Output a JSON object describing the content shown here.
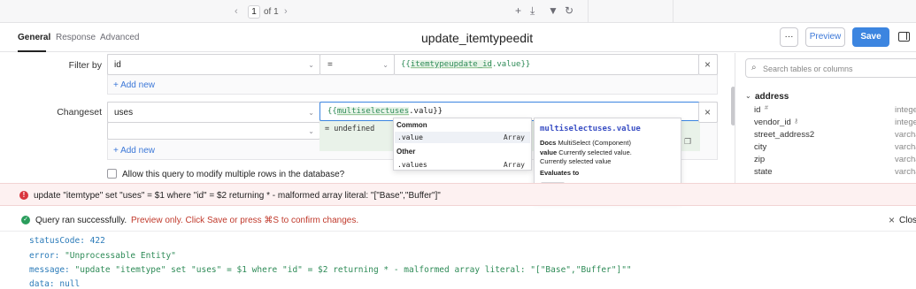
{
  "toolbar": {
    "page_current": "1",
    "page_of": "of 1",
    "prev_icon": "chevron-left-icon",
    "next_icon": "chevron-right-icon",
    "icons": [
      "plus-icon",
      "download-icon",
      "filter-icon",
      "refresh-icon"
    ]
  },
  "header": {
    "tabs": [
      "General",
      "Response",
      "Advanced"
    ],
    "active_tab": "General",
    "title": "update_itemtypeedit",
    "more_label": "···",
    "preview_label": "Preview",
    "save_label": "Save"
  },
  "filter_by": {
    "label": "Filter by",
    "column": "id",
    "operator": "=",
    "value_open": "{{",
    "value_var": "itemtypeupdate_id",
    "value_rest": ".value}}",
    "add_new": "+ Add new"
  },
  "changeset": {
    "label": "Changeset",
    "column": "uses",
    "value_open": "{{",
    "value_var": "multiselectuses",
    "value_rest": ".valu}}",
    "preview_value": "= undefined",
    "add_new": "+ Add new"
  },
  "checkbox": {
    "label": "Allow this query to modify multiple rows in the database?",
    "checked": false
  },
  "autocomplete": {
    "groups": [
      {
        "name": "Common",
        "items": [
          {
            "label": ".value",
            "type": "Array"
          }
        ]
      },
      {
        "name": "Other",
        "items": [
          {
            "label": ".values",
            "type": "Array"
          }
        ]
      }
    ]
  },
  "doc_popup": {
    "title": "multiselectuses.value",
    "docs_label": "Docs",
    "docs_text": "MultiSelect (Component)",
    "value_key": "value",
    "value_desc": "Currently selected value.",
    "value_desc2": "Currently selected value",
    "evaluates_label": "Evaluates to",
    "evaluates_value": "[ ··· ]"
  },
  "sidebar": {
    "search_placeholder": "Search tables or columns",
    "table_name": "address",
    "columns": [
      {
        "name": "id",
        "marker": "#",
        "type": "intege"
      },
      {
        "name": "vendor_id",
        "marker": "⚷",
        "type": "intege"
      },
      {
        "name": "street_address2",
        "marker": "",
        "type": "varcha"
      },
      {
        "name": "city",
        "marker": "",
        "type": "varcha"
      },
      {
        "name": "zip",
        "marker": "",
        "type": "varcha"
      },
      {
        "name": "state",
        "marker": "",
        "type": "varcha"
      }
    ]
  },
  "error": {
    "message": "update \"itemtype\" set \"uses\" = $1 where \"id\" = $2 returning * - malformed array literal: \"[\"Base\",\"Buffer\"]\""
  },
  "status": {
    "success_text": "Query ran successfully.",
    "preview_bold": "Preview only.",
    "preview_rest": "Click Save or press ⌘S to confirm changes.",
    "close_label": "Close"
  },
  "result": {
    "statusCode_key": "statusCode:",
    "statusCode_val": "422",
    "error_key": "error:",
    "error_val": "\"Unprocessable Entity\"",
    "message_key": "message:",
    "message_val": "\"update \"itemtype\" set \"uses\" = $1 where \"id\" = $2 returning * - malformed array literal: \"[\"Base\",\"Buffer\"]\"\"",
    "data_key": "data:",
    "data_val": "null"
  },
  "colors": {
    "accent": "#3c85e0",
    "error_bg": "#fdf1f1",
    "error_icon": "#d9363e",
    "success_icon": "#2a9d5c",
    "code_green": "#2e8b57",
    "code_key": "#2b7bb9"
  }
}
